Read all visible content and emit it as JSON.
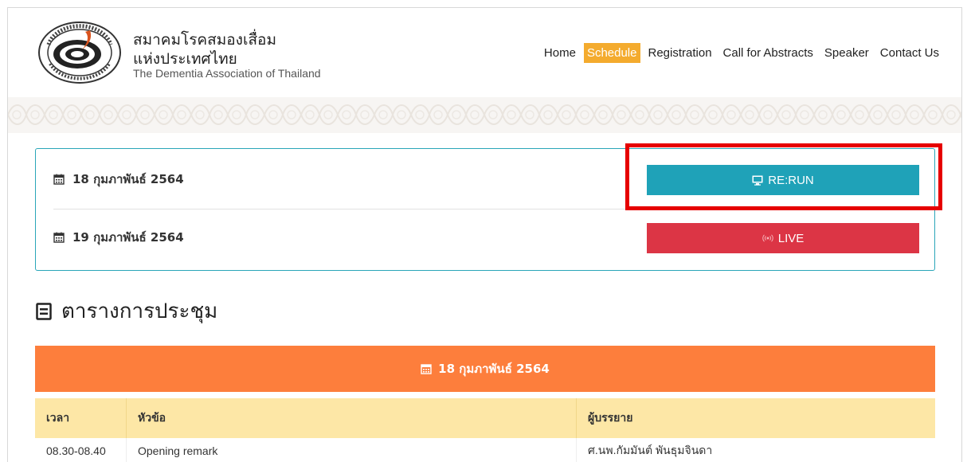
{
  "brand": {
    "name_th_line1": "สมาคมโรคสมองเสื่อม",
    "name_th_line2": "แห่งประเทศไทย",
    "name_en": "The Dementia Association of Thailand"
  },
  "nav": {
    "items": [
      "Home",
      "Schedule",
      "Registration",
      "Call for Abstracts",
      "Speaker",
      "Contact Us"
    ],
    "active": "Schedule"
  },
  "dates": [
    {
      "label": "18 กุมภาพันธ์ 2564",
      "button": "RE:RUN",
      "button_icon": "monitor-icon",
      "button_color": "#1fa2b8"
    },
    {
      "label": "19 กุมภาพันธ์ 2564",
      "button": "LIVE",
      "button_icon": "broadcast-icon",
      "button_color": "#dc3545"
    }
  ],
  "section": {
    "title": "ตารางการประชุม"
  },
  "schedule": {
    "date_banner": "18 กุมภาพันธ์ 2564",
    "columns": [
      "เวลา",
      "หัวข้อ",
      "ผู้บรรยาย"
    ],
    "rows": [
      [
        "08.30-08.40",
        "Opening remark",
        "ศ.นพ.กัมมันต์ พันธุมจินดา"
      ]
    ]
  },
  "colors": {
    "accent_orange": "#fd7e3c",
    "nav_active": "#f4ab2e",
    "panel_border": "#2aa6b9",
    "table_header": "#fde7a6",
    "highlight": "#e60000"
  }
}
